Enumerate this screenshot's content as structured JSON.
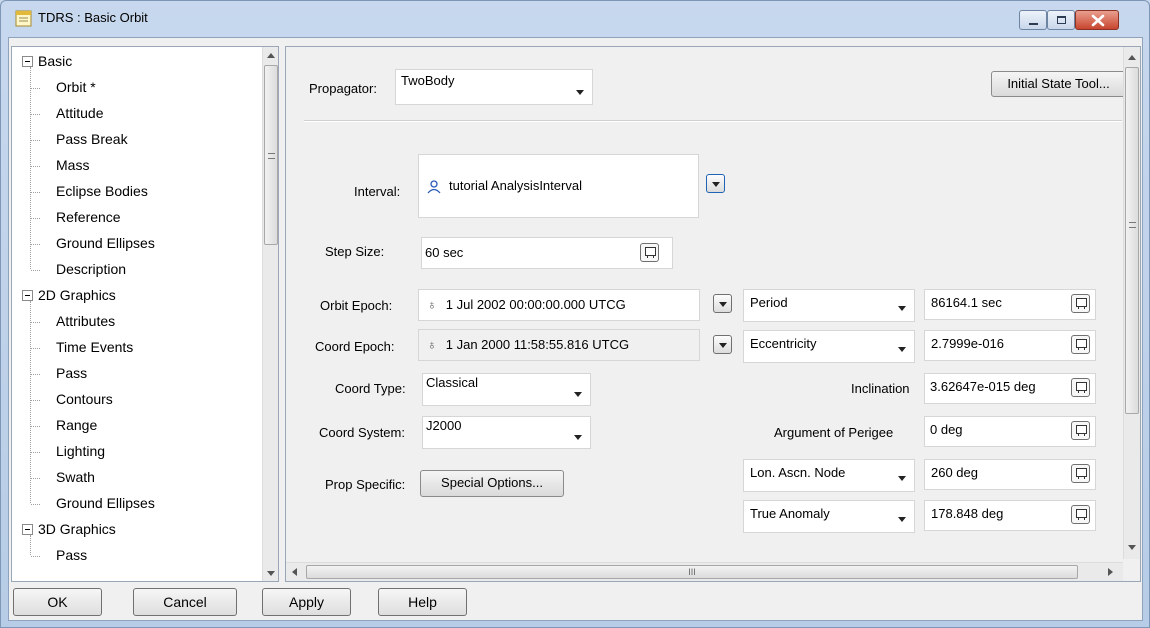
{
  "window": {
    "title": "TDRS : Basic Orbit"
  },
  "tree": {
    "nodes": [
      {
        "label": "Basic",
        "level": 0
      },
      {
        "label": "Orbit *",
        "level": 1
      },
      {
        "label": "Attitude",
        "level": 1
      },
      {
        "label": "Pass Break",
        "level": 1
      },
      {
        "label": "Mass",
        "level": 1
      },
      {
        "label": "Eclipse Bodies",
        "level": 1
      },
      {
        "label": "Reference",
        "level": 1
      },
      {
        "label": "Ground Ellipses",
        "level": 1
      },
      {
        "label": "Description",
        "level": 1
      },
      {
        "label": "2D Graphics",
        "level": 0
      },
      {
        "label": "Attributes",
        "level": 1
      },
      {
        "label": "Time Events",
        "level": 1
      },
      {
        "label": "Pass",
        "level": 1
      },
      {
        "label": "Contours",
        "level": 1
      },
      {
        "label": "Range",
        "level": 1
      },
      {
        "label": "Lighting",
        "level": 1
      },
      {
        "label": "Swath",
        "level": 1
      },
      {
        "label": "Ground Ellipses",
        "level": 1
      },
      {
        "label": "3D Graphics",
        "level": 0
      },
      {
        "label": "Pass",
        "level": 1
      }
    ]
  },
  "orbit": {
    "propagator_label": "Propagator:",
    "propagator_value": "TwoBody",
    "initial_state_tool": "Initial State Tool...",
    "interval_label": "Interval:",
    "interval_value": "tutorial AnalysisInterval",
    "step_size_label": "Step Size:",
    "step_size_value": "60 sec",
    "orbit_epoch_label": "Orbit Epoch:",
    "orbit_epoch_value": "1 Jul 2002 00:00:00.000 UTCG",
    "coord_epoch_label": "Coord Epoch:",
    "coord_epoch_value": "1 Jan 2000 11:58:55.816 UTCG",
    "coord_type_label": "Coord Type:",
    "coord_type_value": "Classical",
    "coord_system_label": "Coord System:",
    "coord_system_value": "J2000",
    "prop_specific_label": "Prop Specific:",
    "special_options": "Special Options...",
    "elements": {
      "period_label": "Period",
      "period_value": "86164.1 sec",
      "ecc_label": "Eccentricity",
      "ecc_value": "2.7999e-016",
      "inc_label": "Inclination",
      "inc_value": "3.62647e-015 deg",
      "argp_label": "Argument of Perigee",
      "argp_value": "0 deg",
      "raan_label": "Lon. Ascn. Node",
      "raan_value": "260 deg",
      "ta_label": "True Anomaly",
      "ta_value": "178.848 deg"
    }
  },
  "hscroll": {
    "grip": "III"
  },
  "buttons": {
    "ok": "OK",
    "cancel": "Cancel",
    "apply": "Apply",
    "help": "Help"
  }
}
